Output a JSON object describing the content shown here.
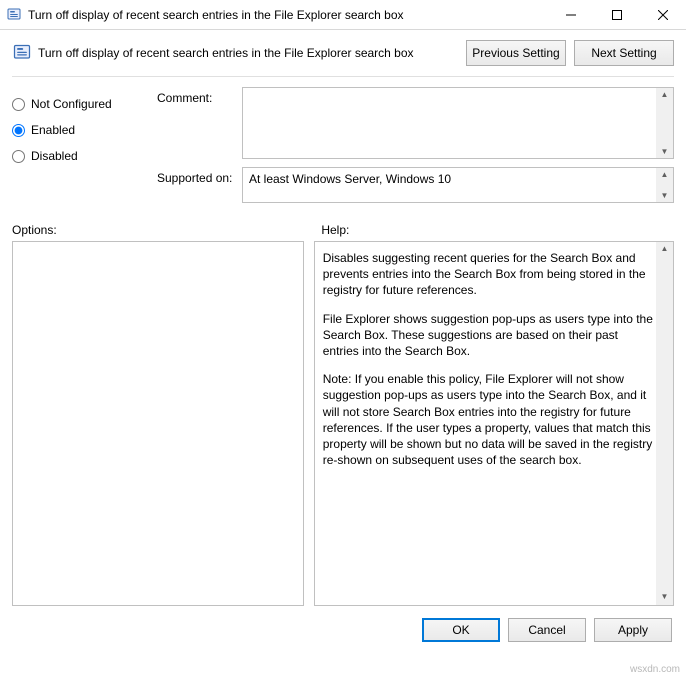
{
  "window": {
    "title": "Turn off display of recent search entries in the File Explorer search box"
  },
  "header": {
    "title": "Turn off display of recent search entries in the File Explorer search box",
    "previous": "Previous Setting",
    "next": "Next Setting"
  },
  "state": {
    "not_configured": "Not Configured",
    "enabled": "Enabled",
    "disabled": "Disabled",
    "selected": "enabled"
  },
  "comment": {
    "label": "Comment:",
    "value": ""
  },
  "supported": {
    "label": "Supported on:",
    "value": "At least Windows Server, Windows 10"
  },
  "sections": {
    "options": "Options:",
    "help": "Help:"
  },
  "options_content": "",
  "help_paragraphs": {
    "p1": "Disables suggesting recent queries for the Search Box and prevents entries into the Search Box from being stored in the registry for future references.",
    "p2": "File Explorer shows suggestion pop-ups as users type into the Search Box.  These suggestions are based on their past entries into the Search Box.",
    "p3": "Note: If you enable this policy, File Explorer will not show suggestion pop-ups as users type into the Search Box, and it will not store Search Box entries into the registry for future references.  If the user types a property, values that match this property will be shown but no data will be saved in the registry re-shown on subsequent uses of the search box."
  },
  "buttons": {
    "ok": "OK",
    "cancel": "Cancel",
    "apply": "Apply"
  },
  "watermark": "wsxdn.com"
}
